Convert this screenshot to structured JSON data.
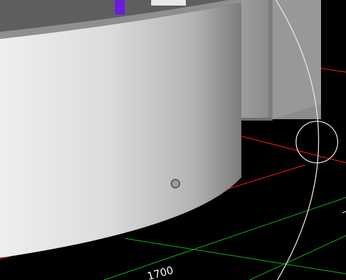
{
  "viewport": {
    "background": "#000000",
    "dimension_label": "1700",
    "colors": {
      "grid_red": "#ff1a1a",
      "grid_green": "#12b512",
      "cylinder_light": "#ececec",
      "cylinder_dark": "#7a7a7a",
      "wall": "#9a9a9a",
      "marker_purple": "#6a1be0",
      "orbit_gizmo": "#e6e6e6"
    },
    "icons": {
      "orbit_gizmo": "orbit-circle-icon",
      "pivot": "pivot-circle-icon"
    }
  }
}
